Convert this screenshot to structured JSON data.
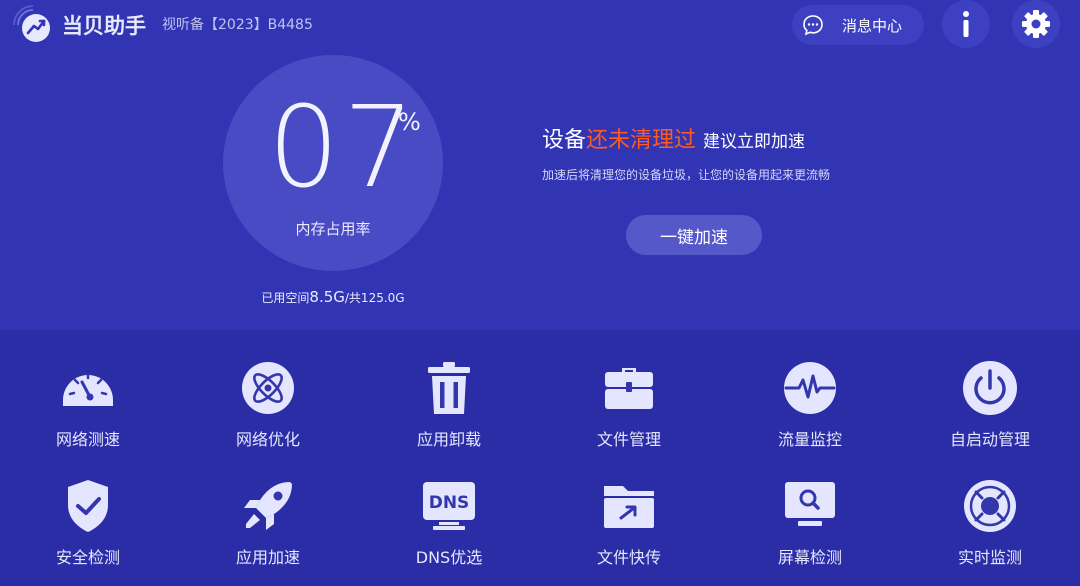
{
  "header": {
    "app_title": "当贝助手",
    "device_name": "视听备【2023】B4485",
    "message_center": "消息中心"
  },
  "memory": {
    "percent_value": "07",
    "percent_unit": "%",
    "label": "内存占用率",
    "storage_prefix": "已用空间",
    "storage_used": "8.5G",
    "storage_total": "/共125.0G"
  },
  "status": {
    "prefix": "设备",
    "alert": "还未清理过",
    "suggestion": "建议立即加速",
    "description": "加速后将清理您的设备垃圾，让您的设备用起来更流畅",
    "boost_button": "一键加速"
  },
  "tools": [
    {
      "label": "网络测速",
      "icon": "speedometer-icon"
    },
    {
      "label": "网络优化",
      "icon": "atom-icon"
    },
    {
      "label": "应用卸载",
      "icon": "trash-icon"
    },
    {
      "label": "文件管理",
      "icon": "toolbox-icon"
    },
    {
      "label": "流量监控",
      "icon": "pulse-icon"
    },
    {
      "label": "自启动管理",
      "icon": "power-icon"
    },
    {
      "label": "安全检测",
      "icon": "shield-check-icon"
    },
    {
      "label": "应用加速",
      "icon": "rocket-icon"
    },
    {
      "label": "DNS优选",
      "icon": "dns-monitor-icon"
    },
    {
      "label": "文件快传",
      "icon": "folder-share-icon"
    },
    {
      "label": "屏幕检测",
      "icon": "screen-search-icon"
    },
    {
      "label": "实时监测",
      "icon": "radar-icon"
    }
  ],
  "colors": {
    "background_top": "#3134b3",
    "background_bottom": "#2a2da6",
    "alert": "#ff5a22",
    "icon_fill": "#e4e6ff",
    "icon_accent": "#3436ac"
  },
  "dns_text": "DNS"
}
